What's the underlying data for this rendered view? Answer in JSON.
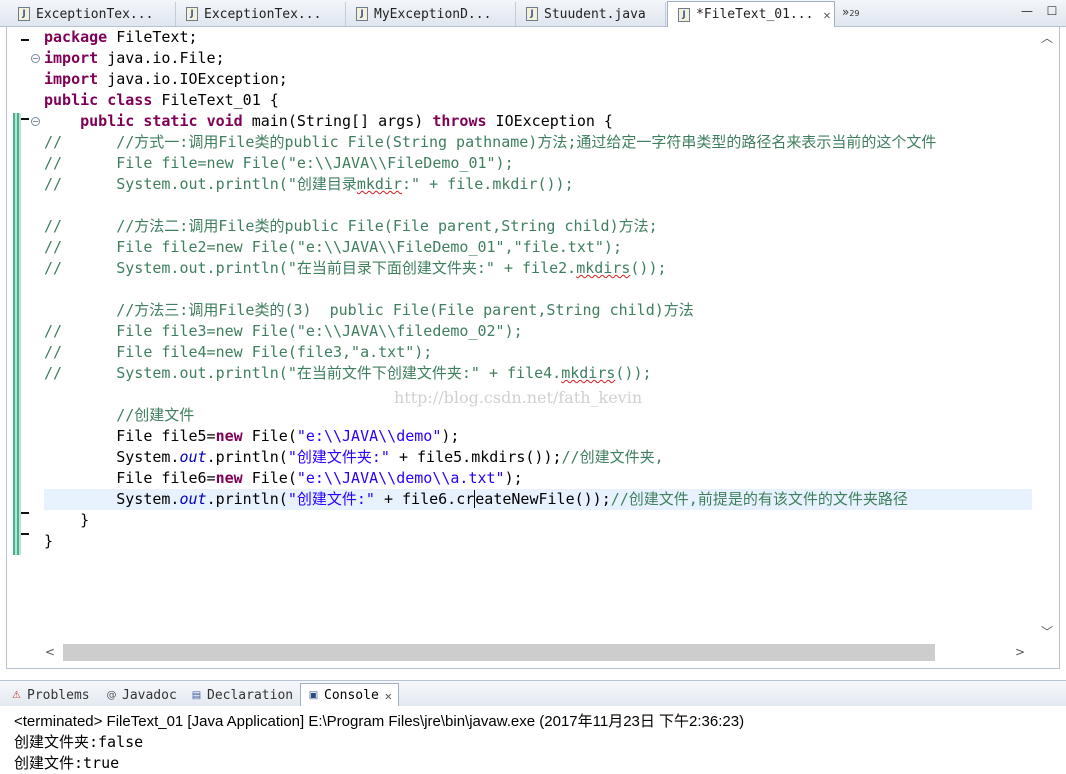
{
  "editor_tabs": [
    {
      "label": "ExceptionTex...",
      "active": false
    },
    {
      "label": "ExceptionTex...",
      "active": false
    },
    {
      "label": "MyExceptionD...",
      "active": false
    },
    {
      "label": "Stuudent.java",
      "active": false
    },
    {
      "label": "*FileText_01...",
      "active": true
    }
  ],
  "overflow": {
    "symbol": "»",
    "count": "29"
  },
  "code_lines": {
    "l1": [
      "package",
      " FileText;"
    ],
    "l2": [
      "import",
      " java.io.File;"
    ],
    "l3": [
      "import",
      " java.io.IOException;"
    ],
    "l4": [
      "public",
      " ",
      "class",
      " FileText_01 {"
    ],
    "l5": [
      "    ",
      "public",
      " ",
      "static",
      " ",
      "void",
      " main(String[] args) ",
      "throws",
      " IOException {"
    ],
    "l6": "//      //方式一:调用File类的public File(String pathname)方法;通过给定一字符串类型的路径名来表示当前的这个文件",
    "l7": "//      File file=new File(\"e:\\\\JAVA\\\\FileDemo_01\");",
    "l8": [
      "//      System.out.println(\"创建目录",
      "mkdir",
      ":\" + file.mkdir());"
    ],
    "l10": "//      //方法二:调用File类的public File(File parent,String child)方法;",
    "l11": "//      File file2=new File(\"e:\\\\JAVA\\\\FileDemo_01\",\"file.txt\");",
    "l12": [
      "//      System.out.println(\"在当前目录下面创建文件夹:\" + file2.",
      "mkdirs",
      "());"
    ],
    "l14": "        //方法三:调用File类的(3)  public File(File parent,String child)方法",
    "l15": "//      File file3=new File(\"e:\\\\JAVA\\\\filedemo_02\");",
    "l16": "//      File file4=new File(file3,\"a.txt\");",
    "l17": [
      "//      System.out.println(\"在当前文件下创建文件夹:\" + file4.",
      "mkdirs",
      "());"
    ],
    "l19": "        //创建文件",
    "l20": [
      "        File file5=",
      "new",
      " File(",
      "\"e:\\\\JAVA\\\\demo\"",
      ");"
    ],
    "l21": [
      "        System.",
      "out",
      ".println(",
      "\"创建文件夹:\"",
      " + file5.mkdirs());",
      "//创建文件夹,"
    ],
    "l22": [
      "        File file6=",
      "new",
      " File(",
      "\"e:\\\\JAVA\\\\demo\\\\a.txt\"",
      ");"
    ],
    "l23": [
      "        System.",
      "out",
      ".println(",
      "\"创建文件:\"",
      " + file6.cr",
      "eateNewFile());",
      "//创建文件,前提是的有该文件的文件夹路径"
    ],
    "l24": "    }",
    "l25": "}"
  },
  "watermark": "http://blog.csdn.net/fath_kevin",
  "panel_tabs": [
    {
      "label": "Problems",
      "icon": "problems-icon"
    },
    {
      "label": "Javadoc",
      "icon": "javadoc-icon"
    },
    {
      "label": "Declaration",
      "icon": "declaration-icon"
    },
    {
      "label": "Console",
      "icon": "console-icon",
      "active": true
    }
  ],
  "console": {
    "terminated": "<terminated> FileText_01 [Java Application] E:\\Program Files\\jre\\bin\\javaw.exe (2017年11月23日 下午2:36:23)",
    "output": [
      "创建文件夹:false",
      "创建文件:true"
    ]
  },
  "colors": {
    "keyword": "#7f0055",
    "string": "#2a00ff",
    "comment": "#3f7f5f",
    "field": "#0000c0"
  }
}
